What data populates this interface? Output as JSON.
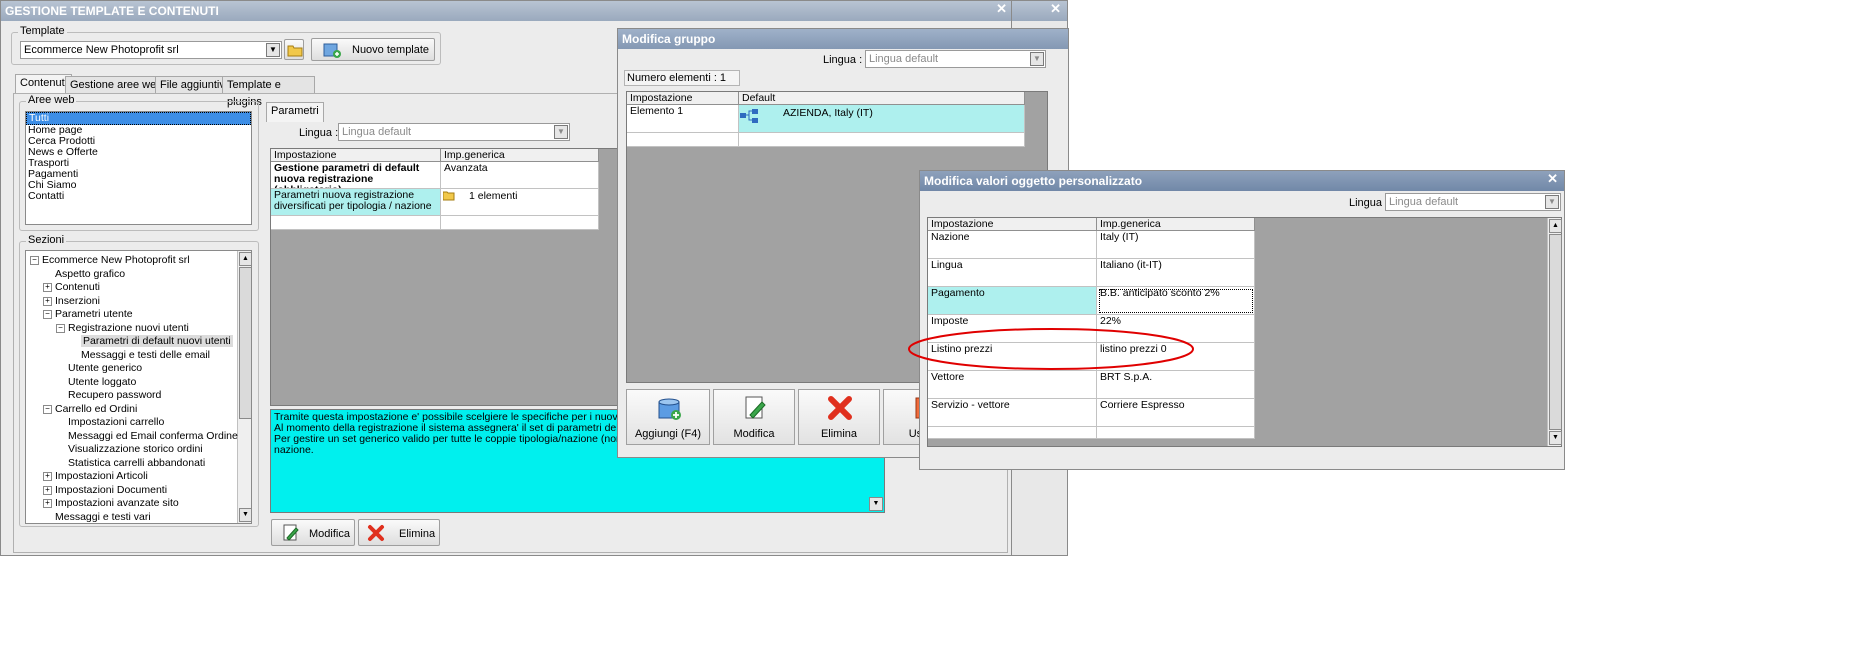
{
  "main": {
    "title": "GESTIONE TEMPLATE E CONTENUTI",
    "close": "✕",
    "template_group": "Template",
    "template_value": "Ecommerce New Photoprofit srl",
    "new_template": "Nuovo template",
    "tabs": [
      "Contenuti",
      "Gestione aree web",
      "File aggiuntivi",
      "Template e plugins"
    ],
    "aree_web_label": "Aree web",
    "aree_web": [
      "Tutti",
      "Home page",
      "Cerca Prodotti",
      "News e Offerte",
      "Trasporti",
      "Pagamenti",
      "Chi Siamo",
      "Contatti"
    ],
    "sezioni_label": "Sezioni",
    "tree": [
      {
        "text": "Ecommerce New Photoprofit srl",
        "level": 0,
        "exp": "−"
      },
      {
        "text": "Aspetto grafico",
        "level": 1,
        "exp": ""
      },
      {
        "text": "Contenuti",
        "level": 1,
        "exp": "+"
      },
      {
        "text": "Inserzioni",
        "level": 1,
        "exp": "+"
      },
      {
        "text": "Parametri utente",
        "level": 1,
        "exp": "−"
      },
      {
        "text": "Registrazione nuovi utenti",
        "level": 2,
        "exp": "−"
      },
      {
        "text": "Parametri di default nuovi utenti",
        "level": 3,
        "exp": "",
        "selected": true
      },
      {
        "text": "Messaggi e testi delle email",
        "level": 3,
        "exp": ""
      },
      {
        "text": "Utente generico",
        "level": 2,
        "exp": ""
      },
      {
        "text": "Utente loggato",
        "level": 2,
        "exp": ""
      },
      {
        "text": "Recupero password",
        "level": 2,
        "exp": ""
      },
      {
        "text": "Carrello ed Ordini",
        "level": 1,
        "exp": "−"
      },
      {
        "text": "Impostazioni carrello",
        "level": 2,
        "exp": ""
      },
      {
        "text": "Messaggi ed Email conferma Ordine",
        "level": 2,
        "exp": ""
      },
      {
        "text": "Visualizzazione storico ordini",
        "level": 2,
        "exp": ""
      },
      {
        "text": "Statistica carrelli abbandonati",
        "level": 2,
        "exp": ""
      },
      {
        "text": "Impostazioni Articoli",
        "level": 1,
        "exp": "+"
      },
      {
        "text": "Impostazioni Documenti",
        "level": 1,
        "exp": "+"
      },
      {
        "text": "Impostazioni avanzate sito",
        "level": 1,
        "exp": "+"
      },
      {
        "text": "Messaggi e testi vari",
        "level": 1,
        "exp": ""
      }
    ],
    "parametri_tab": "Parametri",
    "lingua_label": "Lingua :",
    "lingua_value": "Lingua default",
    "grid_headers": [
      "Impostazione",
      "Imp.generica"
    ],
    "grid_rows": [
      {
        "a": "Gestione parametri di default nuova registrazione (obbligatorio)",
        "b": "Avanzata"
      },
      {
        "a": "Parametri nuova registrazione diversificati per tipologia / nazione",
        "b": "1 elementi"
      }
    ],
    "description": "Tramite questa impostazione e' possibile scelgiere le specifiche per i nuovi utenti in bas\nAl momento della registrazione il sistema assegnera' il set di parametri della prima corri\nPer gestire un set generico valido per tutte le coppie tipologia/nazione (non esplicitate\nnazione.",
    "modifica": "Modifica",
    "elimina": "Elimina"
  },
  "gruppo": {
    "title": "Modifica gruppo",
    "lingua_label": "Lingua :",
    "lingua_value": "Lingua default",
    "num_elementi": "Numero elementi : 1",
    "headers": [
      "Impostazione",
      "Default"
    ],
    "row_a": "Elemento 1",
    "row_b": "AZIENDA, Italy (IT)",
    "aggiungi": "Aggiungi (F4)",
    "modifica": "Modifica",
    "elimina": "Elimina",
    "uscita": "Uscita"
  },
  "valori": {
    "title": "Modifica valori oggetto personalizzato",
    "close": "✕",
    "lingua_label": "Lingua :",
    "lingua_value": "Lingua default",
    "headers": [
      "Impostazione",
      "Imp.generica"
    ],
    "rows": [
      {
        "a": "Nazione",
        "b": "Italy (IT)"
      },
      {
        "a": "Lingua",
        "b": "Italiano (it-IT)"
      },
      {
        "a": "Pagamento",
        "b": "B.B. anticipato sconto  2%"
      },
      {
        "a": "Imposte",
        "b": "22%"
      },
      {
        "a": "Listino prezzi",
        "b": "listino prezzi 0"
      },
      {
        "a": "Vettore",
        "b": "BRT S.p.A."
      },
      {
        "a": "Servizio - vettore",
        "b": "Corriere Espresso"
      }
    ],
    "highlight_color": "#e00000",
    "accent_cyan": "#aef0ee"
  }
}
